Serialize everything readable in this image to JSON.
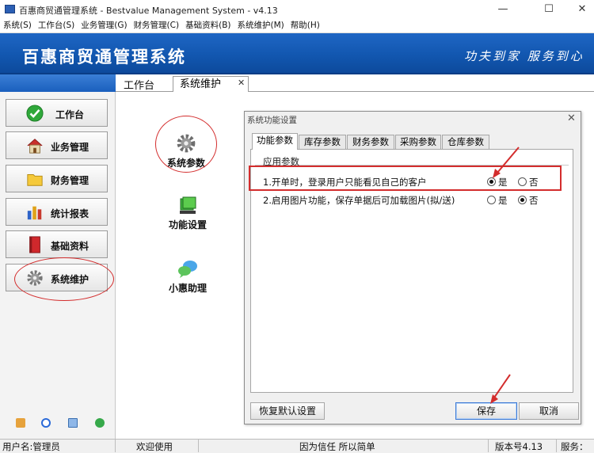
{
  "window": {
    "title": "百惠商贸通管理系统 - Bestvalue Management System - v4.13",
    "minimize_glyph": "—",
    "maximize_glyph": "☐",
    "close_glyph": "✕"
  },
  "menu": {
    "items": [
      "系统(S)",
      "工作台(S)",
      "业务管理(G)",
      "财务管理(C)",
      "基础资料(B)",
      "系统维护(M)",
      "帮助(H)"
    ]
  },
  "banner": {
    "title": "百惠商贸通管理系统",
    "slogan": "功夫到家 服务到心"
  },
  "sidebar": {
    "items": [
      {
        "label": "工作台",
        "icon": "green-check-icon"
      },
      {
        "label": "业务管理",
        "icon": "house-icon"
      },
      {
        "label": "财务管理",
        "icon": "folder-icon"
      },
      {
        "label": "统计报表",
        "icon": "bar-chart-icon"
      },
      {
        "label": "基础资料",
        "icon": "red-book-icon"
      },
      {
        "label": "系统维护",
        "icon": "gear-icon"
      }
    ],
    "bottom_icons": [
      "lock-icon",
      "clock-icon",
      "monitor-icon",
      "power-icon"
    ]
  },
  "tabs": {
    "workbench": "工作台",
    "active": "系统维护",
    "close_glyph": "✕"
  },
  "content": {
    "items": [
      {
        "label": "系统参数",
        "icon": "gear-icon"
      },
      {
        "label": "功能设置",
        "icon": "green-box-icon"
      },
      {
        "label": "小惠助理",
        "icon": "chat-bubbles-icon"
      }
    ]
  },
  "dialog": {
    "title": "系统功能设置",
    "close_glyph": "✕",
    "tabs": [
      "功能参数",
      "库存参数",
      "财务参数",
      "采购参数",
      "仓库参数"
    ],
    "group_title": "应用参数",
    "options": [
      {
        "label": "1.开单时，登录用户只能看见自己的客户",
        "yes": "是",
        "no": "否",
        "selected": "yes"
      },
      {
        "label": "2.启用图片功能，保存单据后可加载图片(拟/送)",
        "yes": "是",
        "no": "否",
        "selected": "no"
      }
    ],
    "buttons": {
      "restore": "恢复默认设置",
      "save": "保存",
      "cancel": "取消"
    }
  },
  "status": {
    "user": "用户名:管理员",
    "welcome": "欢迎使用",
    "motto": "因为信任 所以简单",
    "version": "版本号4.13",
    "service": "服务："
  },
  "annotation_color": "#d32d2d"
}
